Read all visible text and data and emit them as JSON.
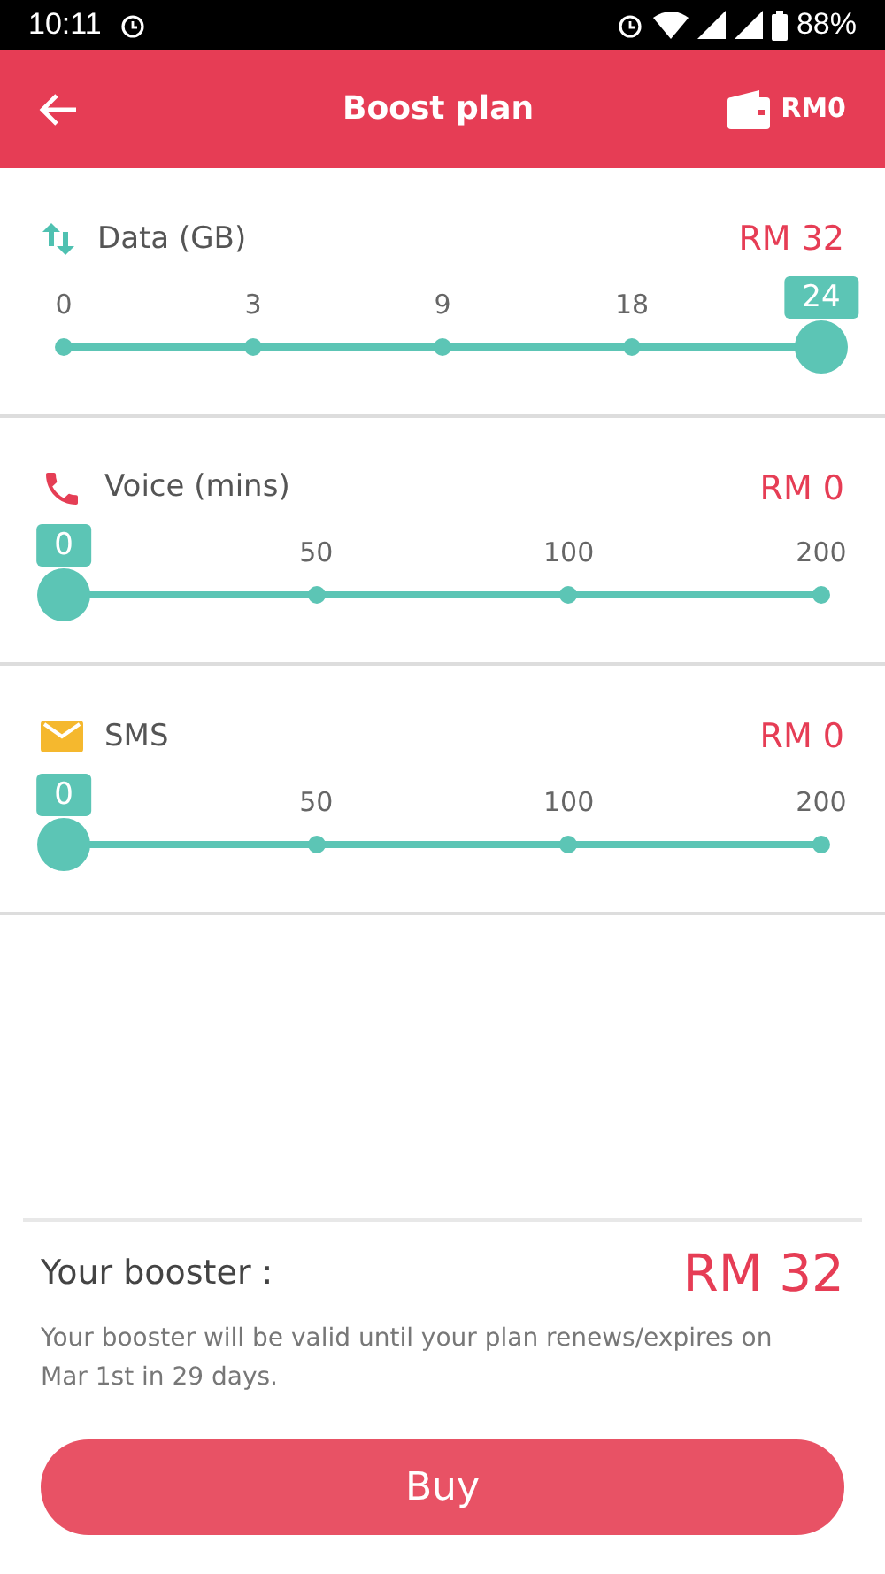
{
  "status_bar": {
    "time": "10:11",
    "battery": "88%"
  },
  "header": {
    "title": "Boost plan",
    "balance": "RM0"
  },
  "plans": [
    {
      "kind": "data",
      "name": "Data (GB)",
      "price": "RM 32",
      "level": 1,
      "stops": [
        {
          "label": "0",
          "selected": false
        },
        {
          "label": "3",
          "selected": false
        },
        {
          "label": "9",
          "selected": false
        },
        {
          "label": "18",
          "selected": false
        },
        {
          "label": "24",
          "selected": true
        }
      ]
    },
    {
      "kind": "voice",
      "name": "Voice (mins)",
      "price": "RM 0",
      "level": 0,
      "stops": [
        {
          "label": "0",
          "selected": true
        },
        {
          "label": "50",
          "selected": false
        },
        {
          "label": "100",
          "selected": false
        },
        {
          "label": "200",
          "selected": false
        }
      ]
    },
    {
      "kind": "sms",
      "name": "SMS",
      "price": "RM 0",
      "level": 0,
      "stops": [
        {
          "label": "0",
          "selected": true
        },
        {
          "label": "50",
          "selected": false
        },
        {
          "label": "100",
          "selected": false
        },
        {
          "label": "200",
          "selected": false
        }
      ]
    }
  ],
  "summary": {
    "label": "Your booster :",
    "total": "RM 32",
    "note": "Your booster will be valid until your plan renews/expires on Mar 1st in 29 days."
  },
  "buy_button": "Buy"
}
